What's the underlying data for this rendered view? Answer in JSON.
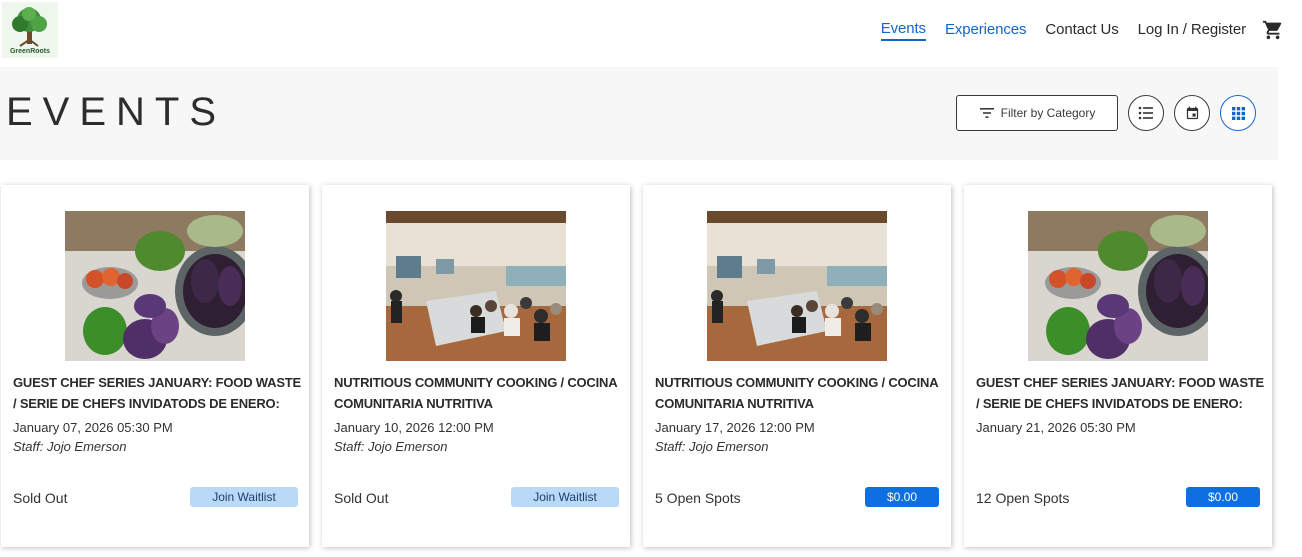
{
  "header": {
    "logo_text": "GreenRoots",
    "nav": [
      {
        "label": "Events",
        "active": true
      },
      {
        "label": "Experiences"
      },
      {
        "label": "Contact Us"
      },
      {
        "label": "Log In / Register"
      }
    ],
    "cart_icon": "shopping-cart-icon"
  },
  "band": {
    "title": "EVENTS",
    "filter_label": "Filter by Category",
    "view_icons": [
      "list-view-icon",
      "calendar-view-icon",
      "grid-view-icon"
    ],
    "active_view": "grid"
  },
  "colors": {
    "accent": "#1565c8",
    "price_button": "#0d6fe0",
    "waitlist_button": "#b9d9f7",
    "band": "#f7f7f7"
  },
  "events": [
    {
      "image": "vegetables-photo",
      "title": "GUEST CHEF SERIES JANUARY: FOOD WASTE / SERIE DE CHEFS INVIDATODS DE ENERO:",
      "date": "January 07, 2026 05:30 PM",
      "staff": "Staff: Jojo Emerson",
      "status": "Sold Out",
      "button": "Join Waitlist"
    },
    {
      "image": "classroom-photo",
      "title": "NUTRITIOUS COMMUNITY COOKING / COCINA COMUNITARIA NUTRITIVA",
      "date": "January 10, 2026 12:00 PM",
      "staff": "Staff: Jojo Emerson",
      "status": "Sold Out",
      "button": "Join Waitlist"
    },
    {
      "image": "classroom-photo",
      "title": "NUTRITIOUS COMMUNITY COOKING / COCINA COMUNITARIA NUTRITIVA",
      "date": "January 17, 2026 12:00 PM",
      "staff": "Staff: Jojo Emerson",
      "status": "5 Open Spots",
      "button": "$0.00"
    },
    {
      "image": "vegetables-photo",
      "title": "GUEST CHEF SERIES JANUARY: FOOD WASTE / SERIE DE CHEFS INVIDATODS DE ENERO:",
      "date": "January 21, 2026 05:30 PM",
      "staff": "",
      "status": "12 Open Spots",
      "button": "$0.00"
    }
  ]
}
